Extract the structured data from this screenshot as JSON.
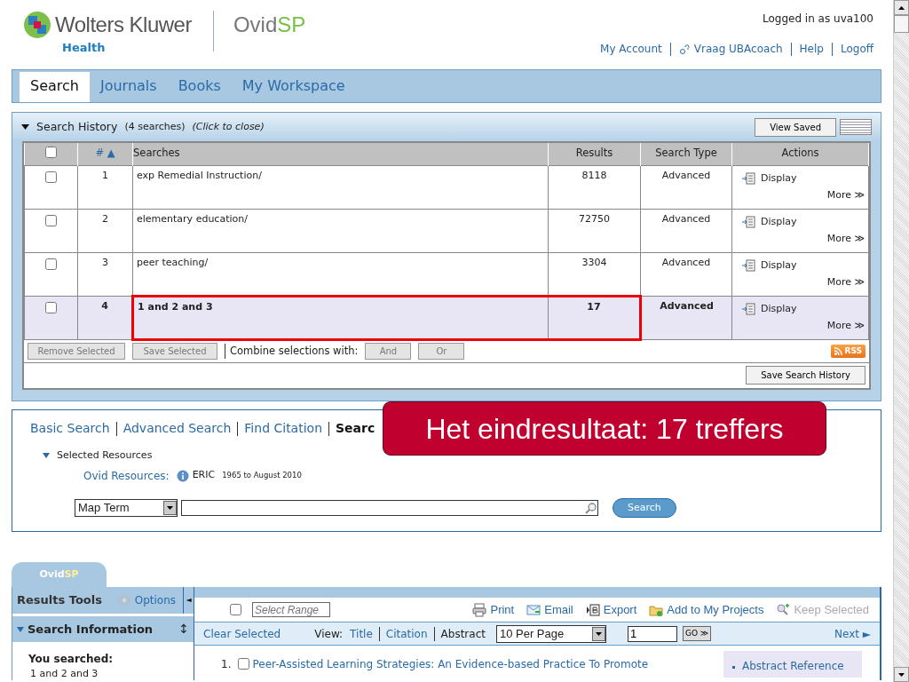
{
  "header": {
    "brand": "Wolters Kluwer",
    "brand_sub": "Health",
    "product": "Ovid",
    "product_accent": "SP",
    "logged_in": "Logged in as uva100",
    "user_links": [
      "My Account",
      "Vraag UBAcoach",
      "Help",
      "Logoff"
    ]
  },
  "nav_tabs": [
    {
      "label": "Search",
      "selected": true
    },
    {
      "label": "Journals",
      "selected": false
    },
    {
      "label": "Books",
      "selected": false
    },
    {
      "label": "My Workspace",
      "selected": false
    }
  ],
  "search_history": {
    "expanded": true,
    "title": "Search History",
    "count": "(4 searches)",
    "hint": "(Click to close)",
    "view_saved": "View Saved",
    "select_all_checked": false,
    "columns": [
      "#",
      "Searches",
      "Results",
      "Search Type",
      "Actions"
    ],
    "sort_indicator": "▲",
    "rows": [
      {
        "checked": false,
        "number": "1",
        "query": "exp Remedial Instruction/",
        "results": "8118",
        "type": "Advanced",
        "display": "Display",
        "more": "More ≫",
        "highlighted": false,
        "marked": false
      },
      {
        "checked": false,
        "number": "2",
        "query": "elementary education/",
        "results": "72750",
        "type": "Advanced",
        "display": "Display",
        "more": "More ≫",
        "highlighted": false,
        "marked": false
      },
      {
        "checked": false,
        "number": "3",
        "query": "peer teaching/",
        "results": "3304",
        "type": "Advanced",
        "display": "Display",
        "more": "More ≫",
        "highlighted": false,
        "marked": false
      },
      {
        "checked": false,
        "number": "4",
        "query": "1 and 2 and 3",
        "results": "17",
        "type": "Advanced",
        "display": "Display",
        "more": "More ≫",
        "highlighted": true,
        "marked": true
      }
    ],
    "buttons": [
      {
        "label": "Remove Selected",
        "disabled": true
      },
      {
        "label": "Save Selected",
        "disabled": true
      }
    ],
    "combine_label": "Combine selections with:",
    "combine_buttons": [
      {
        "label": "And",
        "disabled": true
      },
      {
        "label": "Or",
        "disabled": true
      }
    ],
    "rss": "RSS",
    "save_history": "Save Search History"
  },
  "search_panel": {
    "tabs": [
      {
        "label": "Basic Search",
        "selected": false
      },
      {
        "label": "Advanced Search",
        "selected": false
      },
      {
        "label": "Find Citation",
        "selected": false
      },
      {
        "label": "Searc",
        "selected": true
      }
    ],
    "resources_label": "Selected Resources",
    "ovid_resources_label": "Ovid Resources:",
    "resource": "ERIC",
    "resource_range": "1965 to August 2010",
    "mode": "Map Term",
    "search_button": "Search"
  },
  "callout": "Het eindresultaat: 17 treffers",
  "results": {
    "tab_prefix": "Ovid",
    "tab_accent": "SP",
    "tools_title": "Results Tools",
    "options": "Options",
    "collapse": "◄",
    "info_title": "Search Information",
    "resize": "↕",
    "you_searched": "You searched:",
    "query": "1 and 2 and 3",
    "select_page_checked": false,
    "range_placeholder": "Select Range",
    "actions": [
      {
        "label": "Print",
        "kind": "print",
        "disabled": false
      },
      {
        "label": "Email",
        "kind": "email",
        "disabled": false
      },
      {
        "label": "Export",
        "kind": "export",
        "disabled": false
      },
      {
        "label": "Add to My Projects",
        "kind": "project",
        "disabled": false
      },
      {
        "label": "Keep Selected",
        "kind": "keep",
        "disabled": true
      }
    ],
    "clear_selected": "Clear Selected",
    "view_label": "View:",
    "views": [
      {
        "label": "Title",
        "selected": false
      },
      {
        "label": "Citation",
        "selected": false
      },
      {
        "label": "Abstract",
        "selected": true
      }
    ],
    "per_page": "10 Per Page",
    "page": "1",
    "go": "GO ≫",
    "next": "Next ►",
    "items": [
      {
        "number": "1.",
        "checked": false,
        "title": "Peer-Assisted Learning Strategies: An Evidence-based Practice To Promote"
      }
    ],
    "side_link": "Abstract Reference"
  }
}
